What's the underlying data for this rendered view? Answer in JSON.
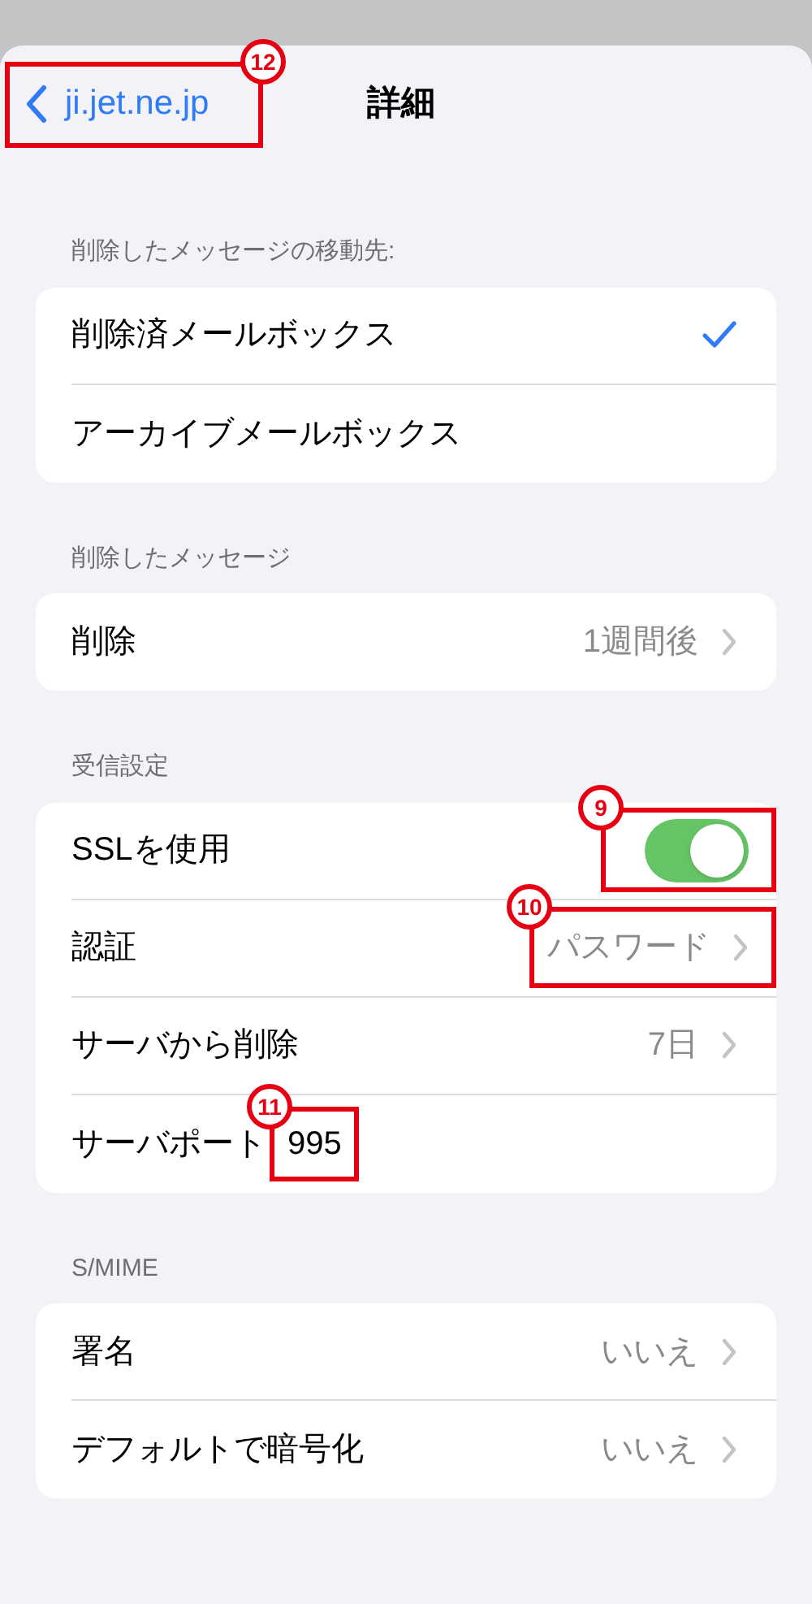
{
  "nav": {
    "back": "ji.jet.ne.jp",
    "back_badge": "12",
    "title": "詳細"
  },
  "sections": [
    {
      "header": "削除したメッセージの移動先:",
      "rows": [
        {
          "kind": "check",
          "label": "削除済メールボックス",
          "selected": true
        },
        {
          "kind": "check",
          "label": "アーカイブメールボックス",
          "selected": false
        }
      ]
    },
    {
      "header": "削除したメッセージ",
      "rows": [
        {
          "kind": "nav",
          "label": "削除",
          "value": "1週間後"
        }
      ]
    },
    {
      "header": "受信設定",
      "rows": [
        {
          "kind": "toggle",
          "label": "SSLを使用",
          "on": true,
          "badge": "9"
        },
        {
          "kind": "nav",
          "label": "認証",
          "value": "パスワード",
          "badge": "10"
        },
        {
          "kind": "nav",
          "label": "サーバから削除",
          "value": "7日"
        },
        {
          "kind": "field",
          "label": "サーバポート",
          "value": "995",
          "badge": "11"
        }
      ]
    },
    {
      "header": "S/MIME",
      "rows": [
        {
          "kind": "nav",
          "label": "署名",
          "value": "いいえ"
        },
        {
          "kind": "nav",
          "label": "デフォルトで暗号化",
          "value": "いいえ"
        }
      ]
    }
  ]
}
